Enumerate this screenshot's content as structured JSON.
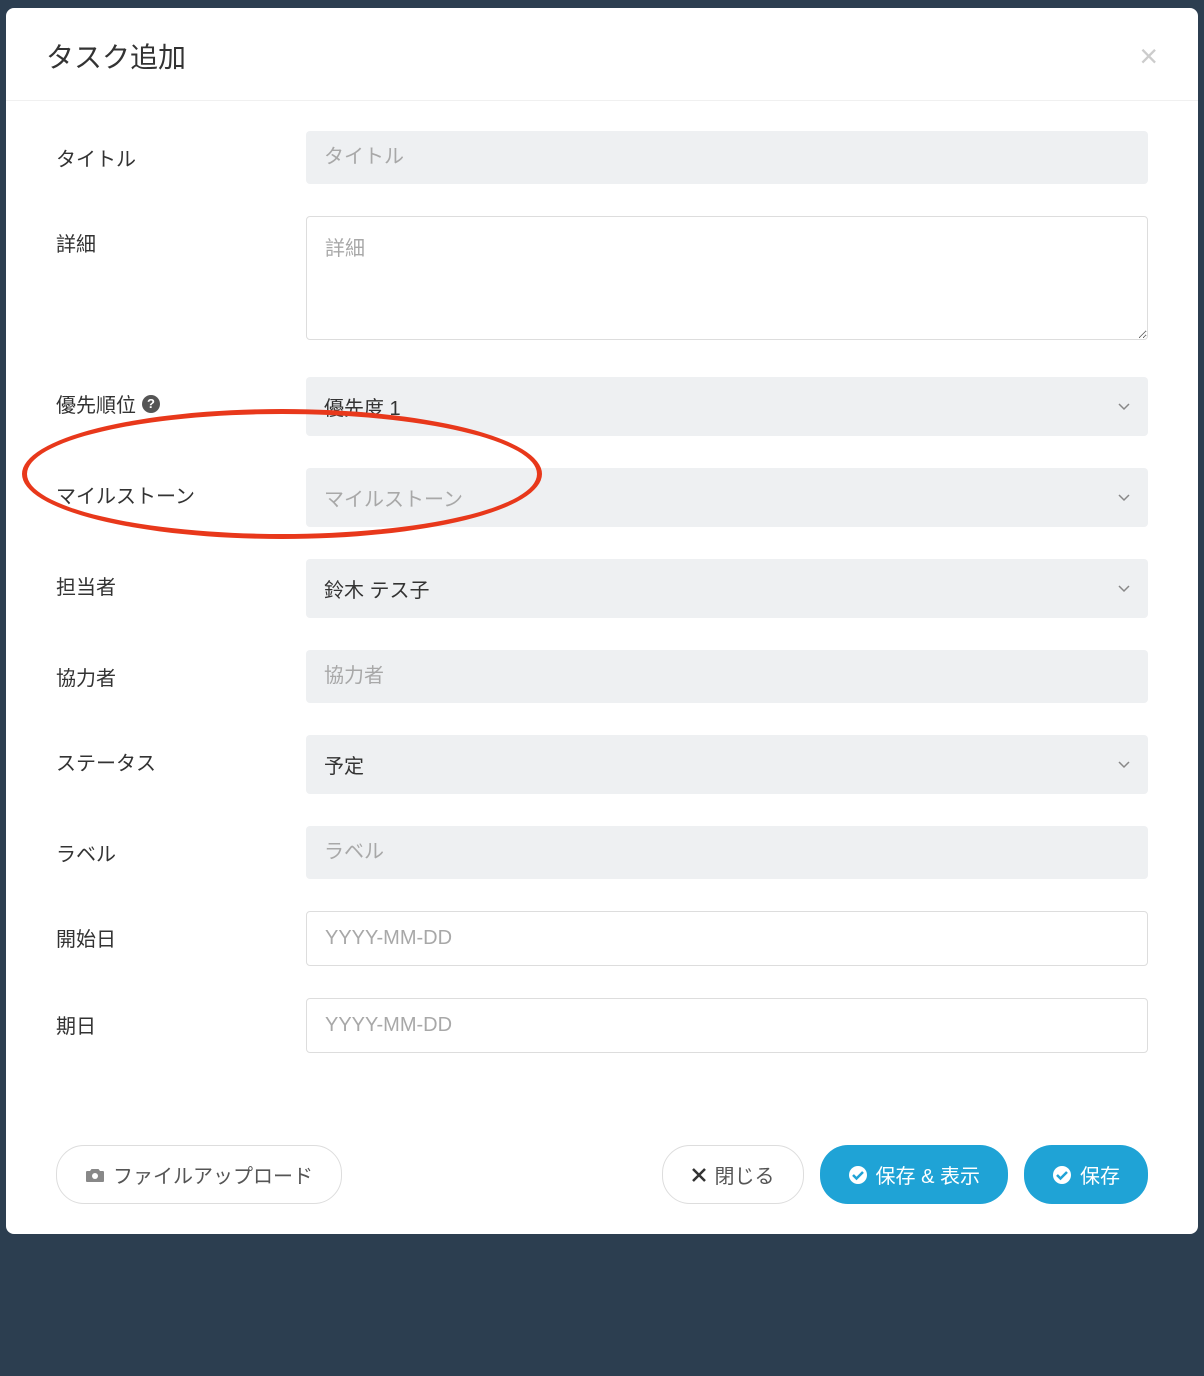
{
  "modal": {
    "title": "タスク追加"
  },
  "fields": {
    "title": {
      "label": "タイトル",
      "placeholder": "タイトル"
    },
    "detail": {
      "label": "詳細",
      "placeholder": "詳細"
    },
    "priority": {
      "label": "優先順位",
      "value": "優先度 1"
    },
    "milestone": {
      "label": "マイルストーン",
      "placeholder": "マイルストーン"
    },
    "assignee": {
      "label": "担当者",
      "value": "鈴木 テス子"
    },
    "collaborator": {
      "label": "協力者",
      "placeholder": "協力者"
    },
    "status": {
      "label": "ステータス",
      "value": "予定"
    },
    "label": {
      "label": "ラベル",
      "placeholder": "ラベル"
    },
    "startDate": {
      "label": "開始日",
      "placeholder": "YYYY-MM-DD"
    },
    "dueDate": {
      "label": "期日",
      "placeholder": "YYYY-MM-DD"
    }
  },
  "buttons": {
    "fileUpload": "ファイルアップロード",
    "close": "閉じる",
    "saveAndShow": "保存 & 表示",
    "save": "保存"
  }
}
